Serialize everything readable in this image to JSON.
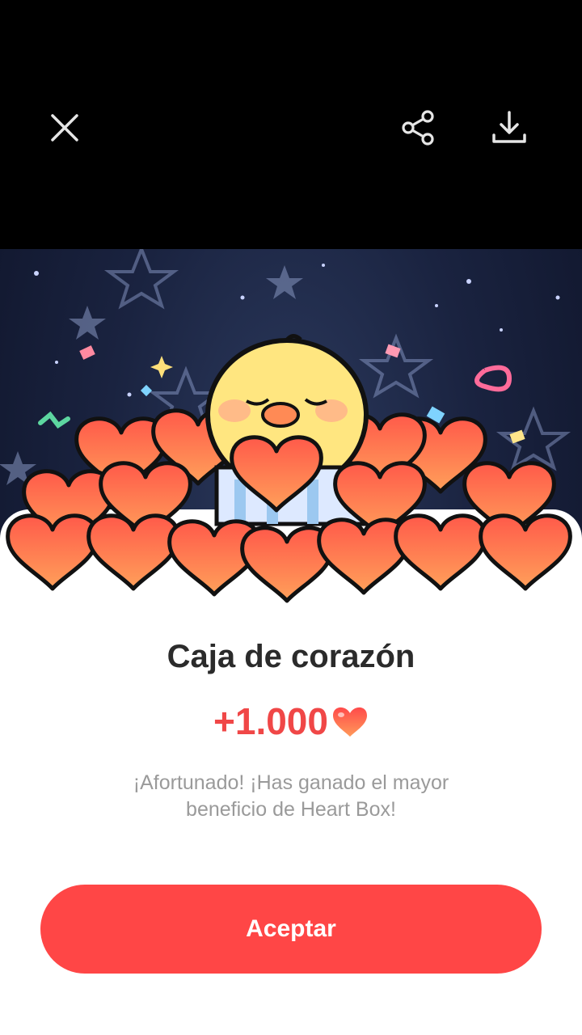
{
  "toolbar": {
    "close_icon": "close-icon",
    "share_icon": "share-icon",
    "download_icon": "download-icon"
  },
  "card": {
    "title": "Caja de corazón",
    "reward_amount": "+1.000",
    "reward_icon": "heart-icon",
    "message": "¡Afortunado! ¡Has ganado el mayor beneficio de Heart Box!",
    "accept_label": "Aceptar"
  },
  "colors": {
    "accent": "#ff4646",
    "reward_text": "#f04747",
    "title_text": "#2b2b2b",
    "muted_text": "#9a9a9a"
  }
}
